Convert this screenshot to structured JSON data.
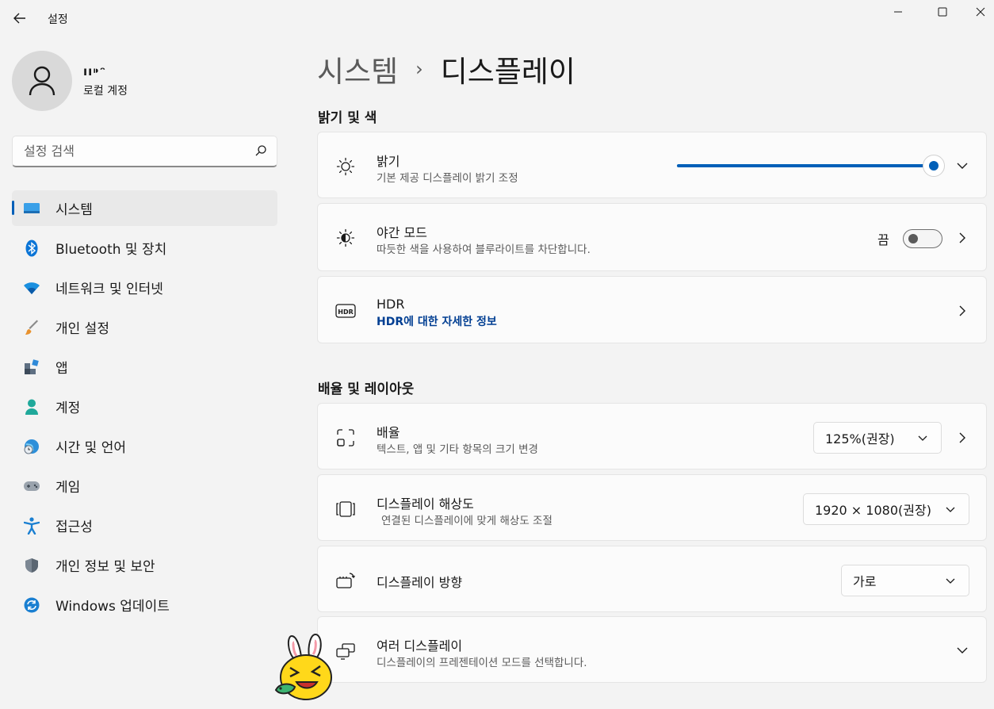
{
  "window": {
    "title": "설정",
    "controls": [
      "minimize-icon",
      "maximize-icon",
      "close-icon"
    ]
  },
  "user": {
    "name": "ıı⁍ᵔ",
    "account_type": "로컬 계정"
  },
  "search": {
    "placeholder": "설정 검색",
    "value": ""
  },
  "sidebar": {
    "items": [
      {
        "label": "시스템",
        "icon": "system-icon",
        "active": true
      },
      {
        "label": "Bluetooth 및 장치",
        "icon": "bluetooth-icon",
        "active": false
      },
      {
        "label": "네트워크 및 인터넷",
        "icon": "wifi-icon",
        "active": false
      },
      {
        "label": "개인 설정",
        "icon": "brush-icon",
        "active": false
      },
      {
        "label": "앱",
        "icon": "apps-icon",
        "active": false
      },
      {
        "label": "계정",
        "icon": "account-icon",
        "active": false
      },
      {
        "label": "시간 및 언어",
        "icon": "globe-clock-icon",
        "active": false
      },
      {
        "label": "게임",
        "icon": "gamepad-icon",
        "active": false
      },
      {
        "label": "접근성",
        "icon": "accessibility-icon",
        "active": false
      },
      {
        "label": "개인 정보 및 보안",
        "icon": "shield-icon",
        "active": false
      },
      {
        "label": "Windows 업데이트",
        "icon": "update-icon",
        "active": false
      }
    ]
  },
  "breadcrumb": {
    "parent": "시스템",
    "separator": "›",
    "current": "디스플레이"
  },
  "sections": {
    "brightness_color": {
      "title": "밝기 및 색",
      "brightness": {
        "title": "밝기",
        "subtitle": "기본 제공 디스플레이 밝기 조정",
        "level": 1.0
      },
      "night_mode": {
        "title": "야간 모드",
        "subtitle": "따듯한 색을 사용하여 블루라이트를 차단합니다.",
        "state_label": "끔",
        "on": false
      },
      "hdr": {
        "title": "HDR",
        "link": "HDR에 대한 자세한 정보"
      }
    },
    "scale_layout": {
      "title": "배율 및 레이아웃",
      "scale": {
        "title": "배율",
        "subtitle": "텍스트, 앱 및 기타 항목의 크기 변경",
        "value": "125%(권장)"
      },
      "resolution": {
        "title": "디스플레이 해상도",
        "subtitle": "연결된 디스플레이에 맞게 해상도 조절",
        "value": "1920 × 1080(권장)"
      },
      "orientation": {
        "title": "디스플레이 방향",
        "value": "가로"
      },
      "multiple": {
        "title": "여러 디스플레이",
        "subtitle": "디스플레이의 프레젠테이션 모드를 선택합니다."
      }
    }
  },
  "colors": {
    "accent": "#005fb8",
    "link": "#003e92",
    "background": "#f3f3f3",
    "card": "#fbfbfb"
  }
}
